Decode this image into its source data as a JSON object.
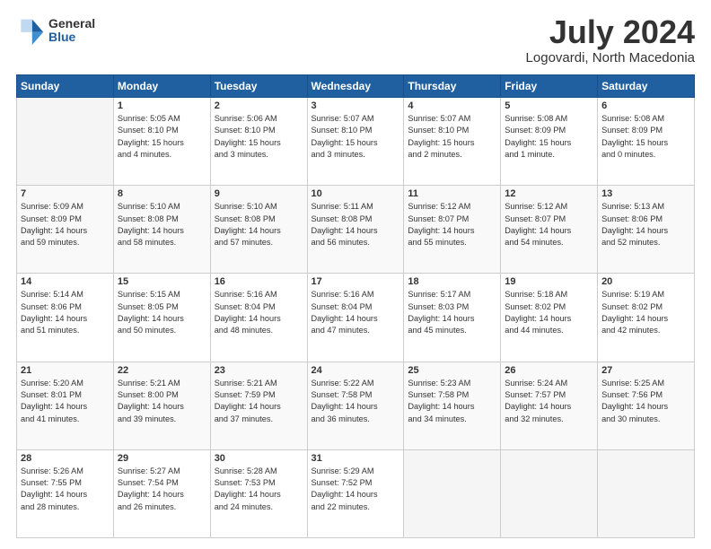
{
  "header": {
    "logo_general": "General",
    "logo_blue": "Blue",
    "title": "July 2024",
    "location": "Logovardi, North Macedonia"
  },
  "days_of_week": [
    "Sunday",
    "Monday",
    "Tuesday",
    "Wednesday",
    "Thursday",
    "Friday",
    "Saturday"
  ],
  "weeks": [
    [
      {
        "day": "",
        "info": []
      },
      {
        "day": "1",
        "info": [
          "Sunrise: 5:05 AM",
          "Sunset: 8:10 PM",
          "Daylight: 15 hours",
          "and 4 minutes."
        ]
      },
      {
        "day": "2",
        "info": [
          "Sunrise: 5:06 AM",
          "Sunset: 8:10 PM",
          "Daylight: 15 hours",
          "and 3 minutes."
        ]
      },
      {
        "day": "3",
        "info": [
          "Sunrise: 5:07 AM",
          "Sunset: 8:10 PM",
          "Daylight: 15 hours",
          "and 3 minutes."
        ]
      },
      {
        "day": "4",
        "info": [
          "Sunrise: 5:07 AM",
          "Sunset: 8:10 PM",
          "Daylight: 15 hours",
          "and 2 minutes."
        ]
      },
      {
        "day": "5",
        "info": [
          "Sunrise: 5:08 AM",
          "Sunset: 8:09 PM",
          "Daylight: 15 hours",
          "and 1 minute."
        ]
      },
      {
        "day": "6",
        "info": [
          "Sunrise: 5:08 AM",
          "Sunset: 8:09 PM",
          "Daylight: 15 hours",
          "and 0 minutes."
        ]
      }
    ],
    [
      {
        "day": "7",
        "info": [
          "Sunrise: 5:09 AM",
          "Sunset: 8:09 PM",
          "Daylight: 14 hours",
          "and 59 minutes."
        ]
      },
      {
        "day": "8",
        "info": [
          "Sunrise: 5:10 AM",
          "Sunset: 8:08 PM",
          "Daylight: 14 hours",
          "and 58 minutes."
        ]
      },
      {
        "day": "9",
        "info": [
          "Sunrise: 5:10 AM",
          "Sunset: 8:08 PM",
          "Daylight: 14 hours",
          "and 57 minutes."
        ]
      },
      {
        "day": "10",
        "info": [
          "Sunrise: 5:11 AM",
          "Sunset: 8:08 PM",
          "Daylight: 14 hours",
          "and 56 minutes."
        ]
      },
      {
        "day": "11",
        "info": [
          "Sunrise: 5:12 AM",
          "Sunset: 8:07 PM",
          "Daylight: 14 hours",
          "and 55 minutes."
        ]
      },
      {
        "day": "12",
        "info": [
          "Sunrise: 5:12 AM",
          "Sunset: 8:07 PM",
          "Daylight: 14 hours",
          "and 54 minutes."
        ]
      },
      {
        "day": "13",
        "info": [
          "Sunrise: 5:13 AM",
          "Sunset: 8:06 PM",
          "Daylight: 14 hours",
          "and 52 minutes."
        ]
      }
    ],
    [
      {
        "day": "14",
        "info": [
          "Sunrise: 5:14 AM",
          "Sunset: 8:06 PM",
          "Daylight: 14 hours",
          "and 51 minutes."
        ]
      },
      {
        "day": "15",
        "info": [
          "Sunrise: 5:15 AM",
          "Sunset: 8:05 PM",
          "Daylight: 14 hours",
          "and 50 minutes."
        ]
      },
      {
        "day": "16",
        "info": [
          "Sunrise: 5:16 AM",
          "Sunset: 8:04 PM",
          "Daylight: 14 hours",
          "and 48 minutes."
        ]
      },
      {
        "day": "17",
        "info": [
          "Sunrise: 5:16 AM",
          "Sunset: 8:04 PM",
          "Daylight: 14 hours",
          "and 47 minutes."
        ]
      },
      {
        "day": "18",
        "info": [
          "Sunrise: 5:17 AM",
          "Sunset: 8:03 PM",
          "Daylight: 14 hours",
          "and 45 minutes."
        ]
      },
      {
        "day": "19",
        "info": [
          "Sunrise: 5:18 AM",
          "Sunset: 8:02 PM",
          "Daylight: 14 hours",
          "and 44 minutes."
        ]
      },
      {
        "day": "20",
        "info": [
          "Sunrise: 5:19 AM",
          "Sunset: 8:02 PM",
          "Daylight: 14 hours",
          "and 42 minutes."
        ]
      }
    ],
    [
      {
        "day": "21",
        "info": [
          "Sunrise: 5:20 AM",
          "Sunset: 8:01 PM",
          "Daylight: 14 hours",
          "and 41 minutes."
        ]
      },
      {
        "day": "22",
        "info": [
          "Sunrise: 5:21 AM",
          "Sunset: 8:00 PM",
          "Daylight: 14 hours",
          "and 39 minutes."
        ]
      },
      {
        "day": "23",
        "info": [
          "Sunrise: 5:21 AM",
          "Sunset: 7:59 PM",
          "Daylight: 14 hours",
          "and 37 minutes."
        ]
      },
      {
        "day": "24",
        "info": [
          "Sunrise: 5:22 AM",
          "Sunset: 7:58 PM",
          "Daylight: 14 hours",
          "and 36 minutes."
        ]
      },
      {
        "day": "25",
        "info": [
          "Sunrise: 5:23 AM",
          "Sunset: 7:58 PM",
          "Daylight: 14 hours",
          "and 34 minutes."
        ]
      },
      {
        "day": "26",
        "info": [
          "Sunrise: 5:24 AM",
          "Sunset: 7:57 PM",
          "Daylight: 14 hours",
          "and 32 minutes."
        ]
      },
      {
        "day": "27",
        "info": [
          "Sunrise: 5:25 AM",
          "Sunset: 7:56 PM",
          "Daylight: 14 hours",
          "and 30 minutes."
        ]
      }
    ],
    [
      {
        "day": "28",
        "info": [
          "Sunrise: 5:26 AM",
          "Sunset: 7:55 PM",
          "Daylight: 14 hours",
          "and 28 minutes."
        ]
      },
      {
        "day": "29",
        "info": [
          "Sunrise: 5:27 AM",
          "Sunset: 7:54 PM",
          "Daylight: 14 hours",
          "and 26 minutes."
        ]
      },
      {
        "day": "30",
        "info": [
          "Sunrise: 5:28 AM",
          "Sunset: 7:53 PM",
          "Daylight: 14 hours",
          "and 24 minutes."
        ]
      },
      {
        "day": "31",
        "info": [
          "Sunrise: 5:29 AM",
          "Sunset: 7:52 PM",
          "Daylight: 14 hours",
          "and 22 minutes."
        ]
      },
      {
        "day": "",
        "info": []
      },
      {
        "day": "",
        "info": []
      },
      {
        "day": "",
        "info": []
      }
    ]
  ]
}
